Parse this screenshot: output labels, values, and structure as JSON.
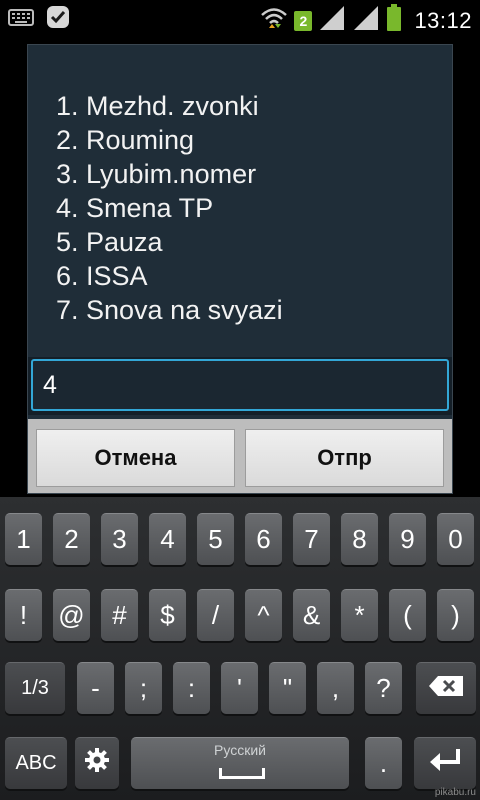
{
  "status_bar": {
    "time": "13:12",
    "notification_count": "2",
    "icons": [
      "keyboard-icon",
      "check-notification-icon",
      "wifi-icon",
      "signal-icon",
      "signal-icon",
      "battery-icon"
    ]
  },
  "dialog": {
    "menu_items": [
      "1. Mezhd. zvonki",
      "2. Rouming",
      "3. Lyubim.nomer",
      "4. Smena TP",
      "5. Pauza",
      "6. ISSA",
      "7. Snova na svyazi"
    ],
    "input_value": "4",
    "cancel_label": "Отмена",
    "send_label": "Отпр"
  },
  "keyboard": {
    "row1": [
      "1",
      "2",
      "3",
      "4",
      "5",
      "6",
      "7",
      "8",
      "9",
      "0"
    ],
    "row2": [
      "!",
      "@",
      "#",
      "$",
      "/",
      "^",
      "&",
      "*",
      "(",
      ")"
    ],
    "row3": {
      "shift": "1/3",
      "keys": [
        "-",
        ";",
        ":",
        "'",
        "\"",
        ",",
        "?"
      ],
      "backspace_icon": "backspace-icon"
    },
    "row4": {
      "abc": "ABC",
      "settings_icon": "gear-icon",
      "language": "Русский",
      "period": ".",
      "enter_icon": "enter-icon"
    }
  },
  "watermark": "pikabu.ru",
  "colors": {
    "accent": "#33a7d6",
    "dialog_bg": "#1f2d38",
    "notification_green": "#79b82c"
  }
}
